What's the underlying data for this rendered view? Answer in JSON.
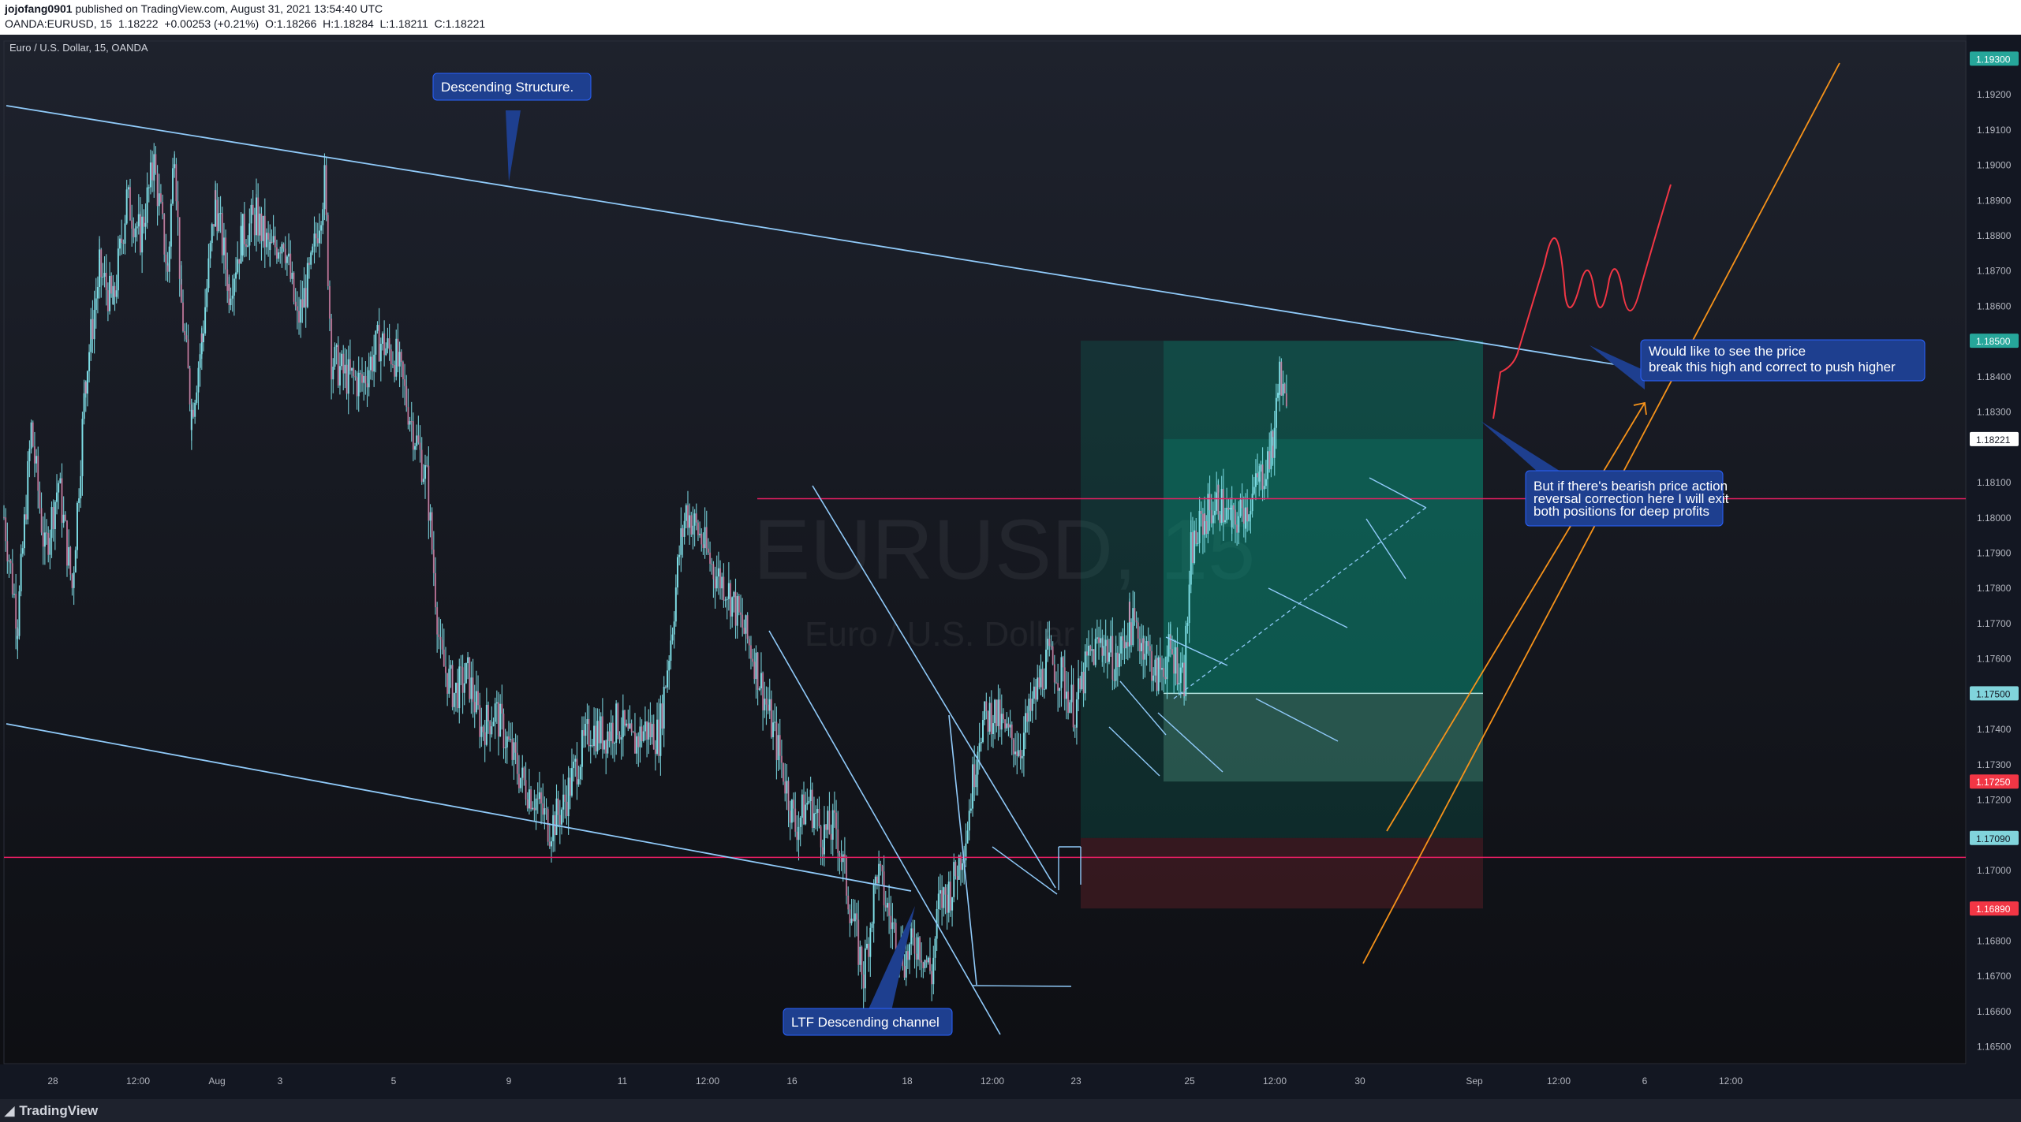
{
  "header": {
    "line1_user": "jojofang0901",
    "line1_rest": "published on TradingView.com, August 31, 2021 13:54:40 UTC",
    "line2_symbol": "OANDA:EURUSD, 15",
    "line2_price": "1.18222",
    "line2_change": "+0.00253 (+0.21%)",
    "line2_o_label": "O:",
    "line2_o": "1.18266",
    "line2_h_label": "H:",
    "line2_h": "1.18284",
    "line2_l_label": "L:",
    "line2_l": "1.18211",
    "line2_c_label": "C:",
    "line2_c": "1.18221"
  },
  "legend": {
    "title": "Euro / U.S. Dollar, 15, OANDA"
  },
  "watermark": {
    "symbol": "EURUSD, 15",
    "name": "Euro / U.S. Dollar"
  },
  "footer": {
    "brand": "TradingView"
  },
  "colors": {
    "up": "#26a69a",
    "down": "#ef5350",
    "candle": "#7fdfe8",
    "trend": "#90caf9",
    "hline": "#e91e63",
    "orange": "#f7931a",
    "sketch": "#f23645",
    "callout": "#1e3f8f",
    "tp": "#089981",
    "sl": "#f23645"
  },
  "annotations": {
    "descending_structure": "Descending Structure.",
    "ltf_channel": "LTF Descending channel",
    "would_like_1": "Would like to see the price",
    "would_like_2": "break this high and correct to push higher",
    "bearish_1": "But if there's bearish price action",
    "bearish_2": "reversal correction here I will exit",
    "bearish_3": "both positions for deep profits"
  },
  "chart_data": {
    "type": "candlestick",
    "title": "Euro / U.S. Dollar, 15, OANDA",
    "symbol": "OANDA:EURUSD",
    "timeframe": "15",
    "ylim": [
      1.1645,
      1.1935
    ],
    "y_ticks": [
      "1.19300",
      "1.19200",
      "1.19100",
      "1.19000",
      "1.18900",
      "1.18800",
      "1.18700",
      "1.18600",
      "1.18500",
      "1.18400",
      "1.18300",
      "1.18221",
      "1.18100",
      "1.18000",
      "1.17900",
      "1.17800",
      "1.17700",
      "1.17600",
      "1.17500",
      "1.17400",
      "1.17300",
      "1.17250",
      "1.17200",
      "1.17090",
      "1.17000",
      "1.16890",
      "1.16800",
      "1.16700",
      "1.16600",
      "1.16500"
    ],
    "x_ticks": [
      "28",
      "12:00",
      "Aug",
      "3",
      "5",
      "9",
      "11",
      "12:00",
      "16",
      "18",
      "12:00",
      "23",
      "25",
      "12:00",
      "30",
      "Sep",
      "12:00",
      "6",
      "12:00"
    ],
    "tick_categories": [
      28,
      12.5,
      31,
      3,
      5,
      9,
      11,
      12.5,
      16,
      18,
      19.5,
      23,
      25,
      26.5,
      30,
      1,
      2.5,
      6,
      7.5
    ],
    "badges": [
      {
        "value": 1.193,
        "label": "1.19300",
        "color": "#26a69a",
        "text": "#ffffff"
      },
      {
        "value": 1.185,
        "label": "1.18500",
        "color": "#26a69a",
        "text": "#ffffff"
      },
      {
        "value": 1.18221,
        "label": "1.18221",
        "color": "#ffffff",
        "text": "#131722"
      },
      {
        "value": 1.175,
        "label": "1.17500",
        "color": "#81d4dc",
        "text": "#131722"
      },
      {
        "value": 1.1725,
        "label": "1.17250",
        "color": "#f23645",
        "text": "#ffffff"
      },
      {
        "value": 1.1709,
        "label": "1.17090",
        "color": "#81d4dc",
        "text": "#131722"
      },
      {
        "value": 1.1689,
        "label": "1.16890",
        "color": "#f23645",
        "text": "#ffffff"
      }
    ],
    "price_path": [
      [
        0,
        1.18
      ],
      [
        0.4,
        1.177
      ],
      [
        0.8,
        1.1825
      ],
      [
        1.2,
        1.179
      ],
      [
        1.6,
        1.181
      ],
      [
        2.0,
        1.178
      ],
      [
        2.4,
        1.184
      ],
      [
        2.8,
        1.187
      ],
      [
        3.2,
        1.186
      ],
      [
        3.6,
        1.189
      ],
      [
        4.0,
        1.188
      ],
      [
        4.4,
        1.19
      ],
      [
        4.8,
        1.187
      ],
      [
        5.0,
        1.1906
      ],
      [
        5.2,
        1.186
      ],
      [
        5.5,
        1.183
      ],
      [
        5.8,
        1.185
      ],
      [
        6.2,
        1.189
      ],
      [
        6.6,
        1.1865
      ],
      [
        7.0,
        1.188
      ],
      [
        7.4,
        1.1885
      ],
      [
        7.8,
        1.1875
      ],
      [
        8.2,
        1.188
      ],
      [
        8.6,
        1.1855
      ],
      [
        9.0,
        1.187
      ],
      [
        9.4,
        1.1895
      ],
      [
        9.6,
        1.1845
      ],
      [
        10.0,
        1.184
      ],
      [
        10.5,
        1.1838
      ],
      [
        11.0,
        1.185
      ],
      [
        11.5,
        1.1845
      ],
      [
        12.0,
        1.1825
      ],
      [
        12.4,
        1.181
      ],
      [
        12.8,
        1.176
      ],
      [
        13.2,
        1.175
      ],
      [
        13.6,
        1.1755
      ],
      [
        14.0,
        1.174
      ],
      [
        14.4,
        1.1745
      ],
      [
        14.8,
        1.1735
      ],
      [
        15.2,
        1.1725
      ],
      [
        15.6,
        1.172
      ],
      [
        16.0,
        1.1712
      ],
      [
        16.4,
        1.1718
      ],
      [
        16.8,
        1.173
      ],
      [
        17.2,
        1.174
      ],
      [
        17.6,
        1.1738
      ],
      [
        18.0,
        1.1742
      ],
      [
        18.4,
        1.1735
      ],
      [
        18.8,
        1.174
      ],
      [
        19.2,
        1.1738
      ],
      [
        19.6,
        1.177
      ],
      [
        19.8,
        1.179
      ],
      [
        20.0,
        1.1802
      ],
      [
        20.4,
        1.1795
      ],
      [
        20.8,
        1.1785
      ],
      [
        21.2,
        1.178
      ],
      [
        21.6,
        1.177
      ],
      [
        22.0,
        1.176
      ],
      [
        22.4,
        1.1745
      ],
      [
        22.8,
        1.173
      ],
      [
        23.2,
        1.1712
      ],
      [
        23.6,
        1.172
      ],
      [
        24.0,
        1.171
      ],
      [
        24.4,
        1.1712
      ],
      [
        24.8,
        1.169
      ],
      [
        25.2,
        1.167
      ],
      [
        25.6,
        1.17
      ],
      [
        26.0,
        1.1685
      ],
      [
        26.4,
        1.1675
      ],
      [
        26.8,
        1.168
      ],
      [
        27.2,
        1.167
      ],
      [
        27.4,
        1.169
      ],
      [
        27.8,
        1.1695
      ],
      [
        28.2,
        1.171
      ],
      [
        28.6,
        1.174
      ],
      [
        29.0,
        1.1745
      ],
      [
        29.4,
        1.1738
      ],
      [
        29.8,
        1.1735
      ],
      [
        30.2,
        1.1748
      ],
      [
        30.6,
        1.176
      ],
      [
        31.0,
        1.1755
      ],
      [
        31.4,
        1.1745
      ],
      [
        31.8,
        1.176
      ],
      [
        32.2,
        1.1765
      ],
      [
        32.6,
        1.1758
      ],
      [
        33.0,
        1.177
      ],
      [
        33.4,
        1.1765
      ],
      [
        33.8,
        1.1755
      ],
      [
        34.2,
        1.1762
      ],
      [
        34.6,
        1.1755
      ],
      [
        34.8,
        1.179
      ],
      [
        35.2,
        1.18
      ],
      [
        35.6,
        1.1805
      ],
      [
        36.0,
        1.1798
      ],
      [
        36.4,
        1.1802
      ],
      [
        36.8,
        1.181
      ],
      [
        37.2,
        1.182
      ],
      [
        37.4,
        1.184
      ],
      [
        37.6,
        1.1828
      ]
    ]
  }
}
